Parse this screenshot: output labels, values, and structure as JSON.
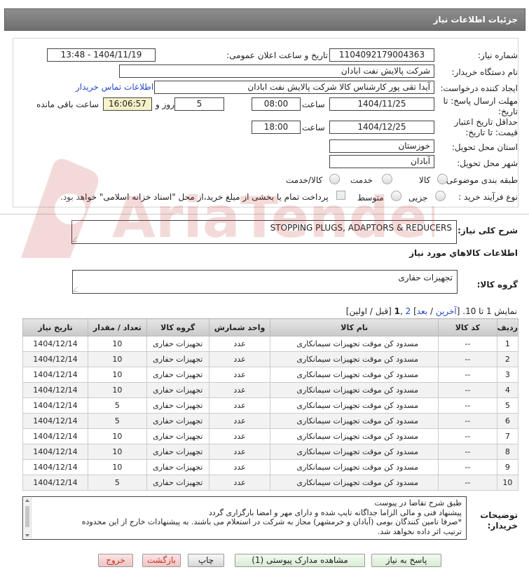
{
  "page": {
    "header_title": "جزئیات اطلاعات نیاز"
  },
  "fields": {
    "need_number_label": "شماره نیاز:",
    "need_number": "1104092179004363",
    "announce_label": "تاریخ و ساعت اعلان عمومی:",
    "announce_value": "1404/11/19 - 13:48",
    "buyer_org_label": "نام دستگاه خریدار:",
    "buyer_org": "شرکت پالایش نفت ابادان",
    "creator_label": "ایجاد کننده درخواست:",
    "creator": "آیدا تقی پور کارشناس کالا شرکت پالایش نفت ابادان",
    "contact_link": "اطلاعات تماس خریدار",
    "deadline_label_1": "مهلت ارسال پاسخ: تا",
    "deadline_label_2": "تاریخ:",
    "deadline_date": "1404/11/25",
    "time_label": "ساعت",
    "deadline_time": "08:00",
    "days_value": "5",
    "days_label": "روز و",
    "remaining_time": "16:06:57",
    "remaining_label": "ساعت باقی مانده",
    "validity_label_1": "حداقل تاریخ اعتبار",
    "validity_label_2": "قیمت: تا تاریخ:",
    "validity_date": "1404/12/25",
    "validity_time": "18:00",
    "province_label": "استان محل تحویل:",
    "province": "خوزستان",
    "city_label": "شهر محل تحویل:",
    "city": "آبادان",
    "category_label": "طبقه بندی موضوعی:",
    "category_options": [
      "کالا",
      "خدمت",
      "کالا/خدمت"
    ],
    "purchase_type_label": "نوع فرآیند خرید :",
    "purchase_options": [
      "جزیی",
      "متوسط"
    ],
    "payment_note": "پرداخت تمام یا بخشی از مبلغ خرید،از محل \"اسناد خزانه اسلامی\" خواهد بود."
  },
  "summary": {
    "desc_label": "شرح کلی نیاز:",
    "desc_value": "STOPPING PLUGS, ADAPTORS & REDUCERS",
    "goods_info_title": "اطلاعات کالاهاي مورد نياز",
    "group_label": "گروه کالا:",
    "group_value": "تجهیزات حفاری"
  },
  "pager": {
    "prefix": "نمایش 1 تا 10. [",
    "last": "آخرین",
    "sep1": " / ",
    "next": "بعد",
    "mid": "] ",
    "page2": "2",
    "comma": " ,",
    "page1": "1",
    "suffix": " [قبل / اولین]"
  },
  "table": {
    "headers": [
      "ردیف",
      "کد کالا",
      "نام کالا",
      "واحد شمارش",
      "گروه کالا",
      "تعداد / مقدار",
      "تاریخ نیاز"
    ],
    "rows": [
      [
        "1",
        "--",
        "مسدود کن موقت تجهیزات سیمانکاری",
        "عدد",
        "تجهیزات حفاری",
        "10",
        "1404/12/14"
      ],
      [
        "2",
        "--",
        "مسدود کن موقت تجهیزات سیمانکاری",
        "عدد",
        "تجهیزات حفاری",
        "10",
        "1404/12/14"
      ],
      [
        "3",
        "--",
        "مسدود کن موقت تجهیزات سیمانکاری",
        "عدد",
        "تجهیزات حفاری",
        "10",
        "1404/12/14"
      ],
      [
        "4",
        "--",
        "مسدود کن موقت تجهیزات سیمانکاری",
        "عدد",
        "تجهیزات حفاری",
        "10",
        "1404/12/14"
      ],
      [
        "5",
        "--",
        "مسدود کن موقت تجهیزات سیمانکاری",
        "عدد",
        "تجهیزات حفاری",
        "5",
        "1404/12/14"
      ],
      [
        "6",
        "--",
        "مسدود کن موقت تجهیزات سیمانکاری",
        "عدد",
        "تجهیزات حفاری",
        "5",
        "1404/12/14"
      ],
      [
        "7",
        "--",
        "مسدود کن موقت تجهیزات سیمانکاری",
        "عدد",
        "تجهیزات حفاری",
        "10",
        "1404/12/14"
      ],
      [
        "8",
        "--",
        "مسدود کن موقت تجهیزات سیمانکاری",
        "عدد",
        "تجهیزات حفاری",
        "10",
        "1404/12/14"
      ],
      [
        "9",
        "--",
        "مسدود کن موقت تجهیزات سیمانکاری",
        "عدد",
        "تجهیزات حفاری",
        "10",
        "1404/12/14"
      ],
      [
        "10",
        "--",
        "مسدود کن موقت تجهیزات سیمانکاری",
        "عدد",
        "تجهیزات حفاری",
        "5",
        "1404/12/14"
      ]
    ]
  },
  "notes": {
    "label_1": "توضیحات",
    "label_2": "خریدار:",
    "lines": [
      "طبق شرح تقاضا در پیوست",
      "پیشنهاد فنی و مالی الزاما جداگانه تایپ شده و دارای مهر و امضا بارگزاری گردد",
      "*صرفا تامین کنندگان بومی (آبادان و خرمشهر) مجاز به شرکت در استعلام می باشند. به پیشنهادات خارج از این محدوده",
      "ترتیب اثر داده نخواهد شد."
    ]
  },
  "buttons": {
    "reply": "پاسخ به نیاز",
    "attachments": "مشاهده مدارک پیوستی (1)",
    "print": "چاپ",
    "back": "بازگشت",
    "exit": "خروج"
  },
  "watermark": {
    "text": "AriaTender.net"
  },
  "colors": {
    "link": "#2448c9",
    "highlight": "#f6f1c8",
    "header": "#7f7f7f",
    "watermark": "#c0392b"
  }
}
